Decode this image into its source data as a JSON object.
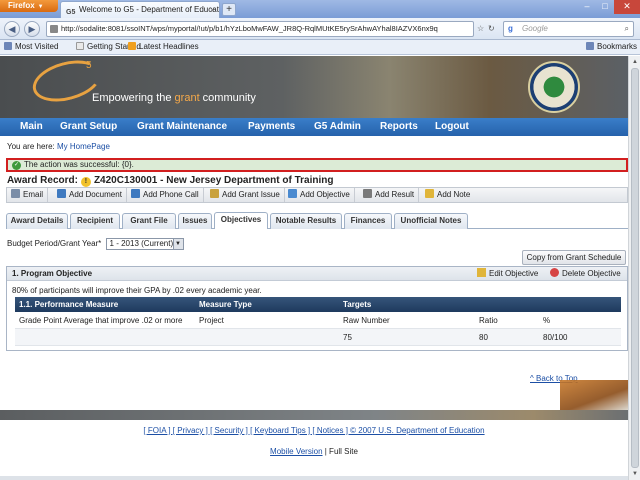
{
  "browser": {
    "app_button": "Firefox",
    "tab_title": "Welcome to G5 - Department of Educati...",
    "tab_favicon": "G5",
    "url": "http://sodalite:8081/ssoINT/wps/myportal/!ut/p/b1/hYzLboMwFAW_JR8Q-RqlMUtKE5rySrAhwAYhal8IAZVX6nx9q",
    "search_placeholder": "Google",
    "bookmarks": [
      "Most Visited",
      "Getting Started",
      "Latest Headlines"
    ],
    "bookmarks_menu": "Bookmarks"
  },
  "banner": {
    "logo_text": "G",
    "logo_sup": "5",
    "tagline_pre": "Empowering the ",
    "tagline_highlight": "grant",
    "tagline_post": " community"
  },
  "menu": [
    "Main",
    "Grant Setup",
    "Grant Maintenance",
    "Payments",
    "G5 Admin",
    "Reports",
    "Logout"
  ],
  "breadcrumb": {
    "prefix": "You are here:",
    "link": "My HomePage"
  },
  "success_message": "The action was successful: {0}.",
  "award": {
    "label": "Award Record:",
    "number": "Z420C130001 - New Jersey Department of Training"
  },
  "actions": [
    "Email",
    "Add Document",
    "Add Phone Call",
    "Add Grant Issue",
    "Add Objective",
    "Add Result",
    "Add Note"
  ],
  "tabs": [
    "Award Details",
    "Recipient",
    "Grant File",
    "Issues",
    "Objectives",
    "Notable Results",
    "Finances",
    "Unofficial Notes"
  ],
  "budget": {
    "label": "Budget Period/Grant Year*",
    "selected": "1 - 2013 (Current)"
  },
  "copy_button": "Copy from Grant Schedule",
  "objective": {
    "title": "1. Program Objective",
    "edit": "Edit Objective",
    "delete": "Delete Objective",
    "text": "80% of participants will improve their GPA by .02 every academic year.",
    "headers": [
      "1.1. Performance Measure",
      "Measure Type",
      "Targets"
    ],
    "row1": [
      "Grade Point Average that improve .02 or more",
      "Project",
      "Raw Number",
      "Ratio",
      "%"
    ],
    "row2": [
      "75",
      "80",
      "80/100"
    ]
  },
  "back_to_top": "^ Back to Top",
  "footer": {
    "links": "[ FOIA ] [ Privacy ] [ Security ] [ Keyboard Tips ] [ Notices ] © 2007 U.S. Department of Education",
    "mobile": "Mobile Version",
    "full_site": " | Full Site"
  },
  "colors": {
    "menu_bg": "#2a6bb8",
    "success_bg": "#dcebd6",
    "success_border": "#d21f1f",
    "table_header": "#1e3a5e",
    "accent_orange": "#e8a241"
  }
}
